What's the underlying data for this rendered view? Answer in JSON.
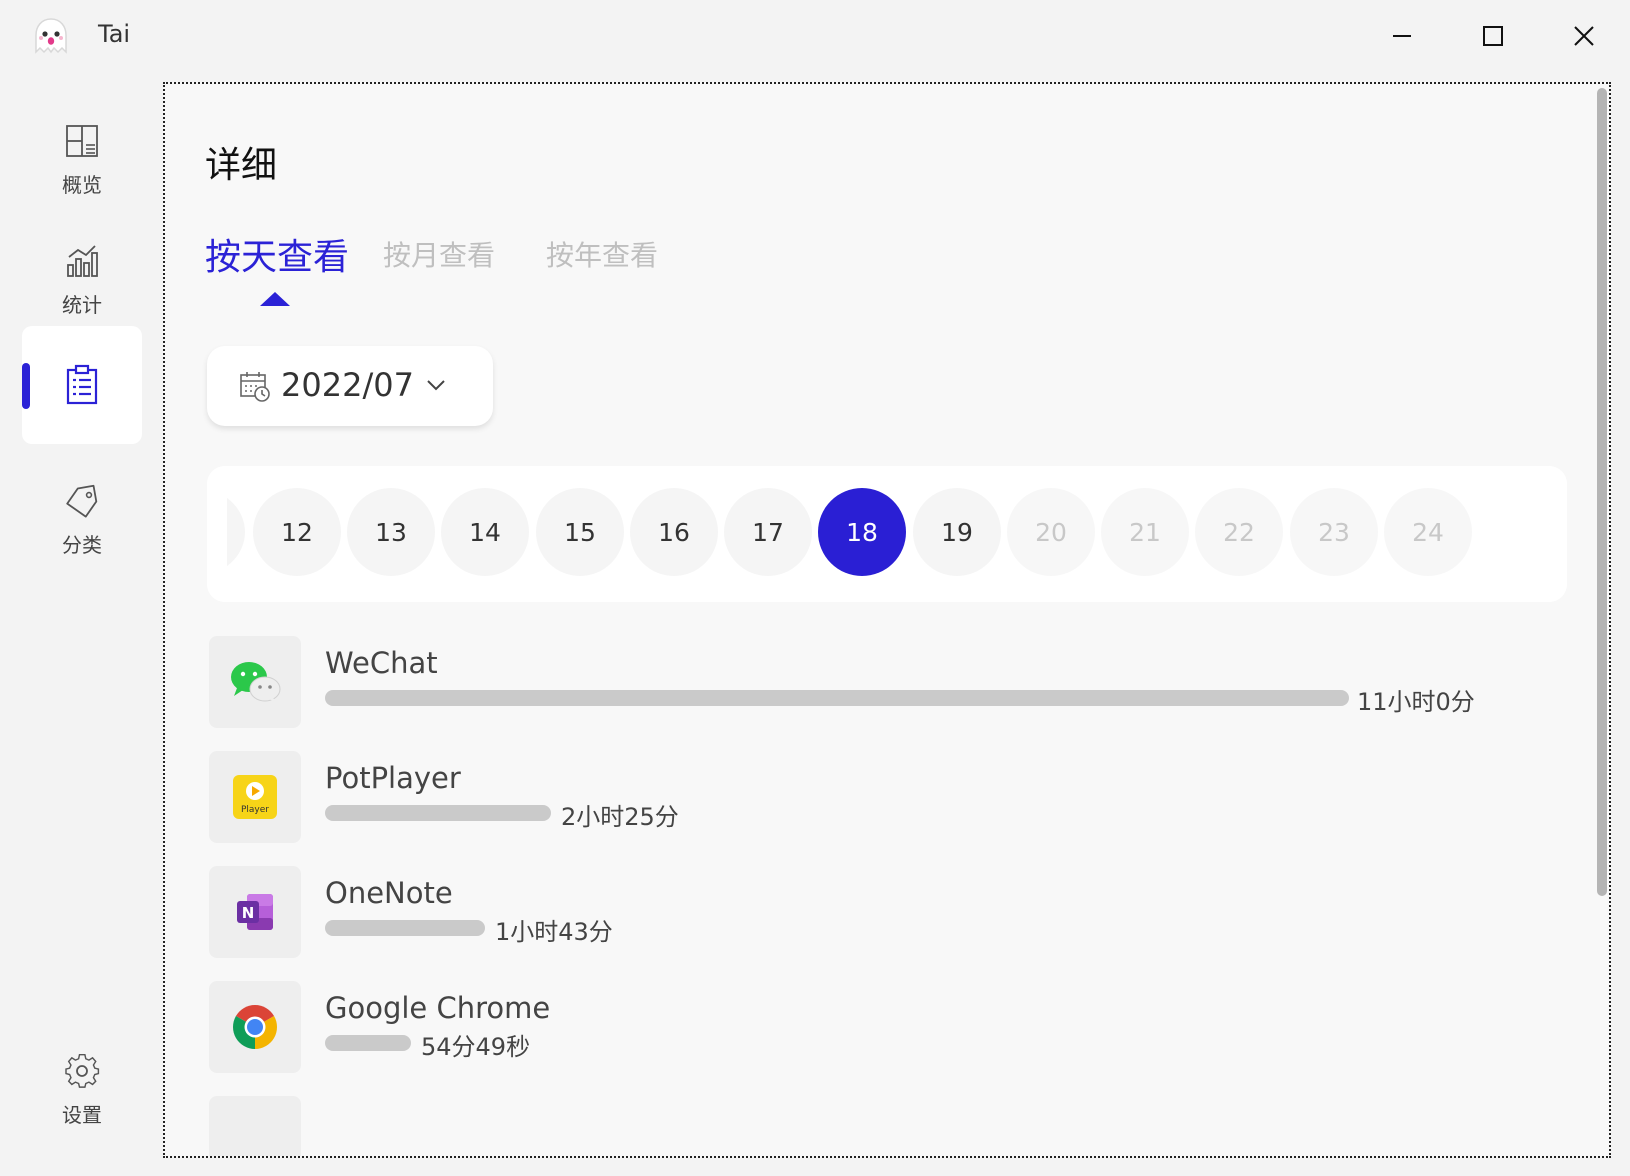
{
  "window": {
    "title": "Tai"
  },
  "sidebar": {
    "items": [
      {
        "label": "概览",
        "icon": "dashboard-icon"
      },
      {
        "label": "统计",
        "icon": "chart-icon"
      },
      {
        "label": "",
        "icon": "clipboard-list-icon",
        "active": true
      },
      {
        "label": "分类",
        "icon": "tag-icon"
      },
      {
        "label": "设置",
        "icon": "gear-icon"
      }
    ]
  },
  "main": {
    "title": "详细",
    "tabs": [
      {
        "label": "按天查看",
        "active": true
      },
      {
        "label": "按月查看"
      },
      {
        "label": "按年查看"
      }
    ],
    "month_picker": {
      "value": "2022/07"
    },
    "days": [
      {
        "label": "12",
        "state": "normal"
      },
      {
        "label": "13",
        "state": "normal"
      },
      {
        "label": "14",
        "state": "normal"
      },
      {
        "label": "15",
        "state": "normal"
      },
      {
        "label": "16",
        "state": "normal"
      },
      {
        "label": "17",
        "state": "normal"
      },
      {
        "label": "18",
        "state": "selected"
      },
      {
        "label": "19",
        "state": "normal"
      },
      {
        "label": "20",
        "state": "future"
      },
      {
        "label": "21",
        "state": "future"
      },
      {
        "label": "22",
        "state": "future"
      },
      {
        "label": "23",
        "state": "future"
      },
      {
        "label": "24",
        "state": "future"
      }
    ],
    "apps": [
      {
        "name": "WeChat",
        "duration": "11小时0分",
        "share": 1.0,
        "icon": "wechat-icon"
      },
      {
        "name": "PotPlayer",
        "duration": "2小时25分",
        "share": 0.22,
        "icon": "potplayer-icon"
      },
      {
        "name": "OneNote",
        "duration": "1小时43分",
        "share": 0.156,
        "icon": "onenote-icon"
      },
      {
        "name": "Google Chrome",
        "duration": "54分49秒",
        "share": 0.083,
        "icon": "chrome-icon"
      }
    ]
  },
  "colors": {
    "accent": "#2b22d6",
    "bar": "#cacaca"
  }
}
